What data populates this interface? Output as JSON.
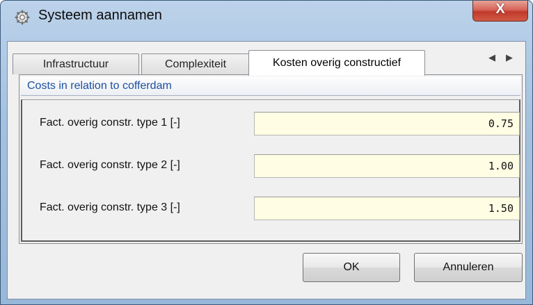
{
  "window": {
    "title": "Systeem aannamen",
    "close_label": "X"
  },
  "tabs": [
    {
      "label": "Infrastructuur",
      "active": false
    },
    {
      "label": "Complexiteit",
      "active": false
    },
    {
      "label": "Kosten overig constructief",
      "active": true
    }
  ],
  "tab_scroll": {
    "left": "◀",
    "right": "▶"
  },
  "group": {
    "title": "Costs in relation to cofferdam",
    "fields": [
      {
        "label": "Fact. overig constr. type 1 [-]",
        "value": "0.75"
      },
      {
        "label": "Fact. overig constr. type 2 [-]",
        "value": "1.00"
      },
      {
        "label": "Fact. overig constr. type 3 [-]",
        "value": "1.50"
      }
    ]
  },
  "buttons": {
    "ok_label": "OK",
    "cancel_label": "Annuleren"
  },
  "colors": {
    "accent_text": "#1c4f9f",
    "input_background": "#fffde3",
    "close_button": "#c0392b"
  }
}
